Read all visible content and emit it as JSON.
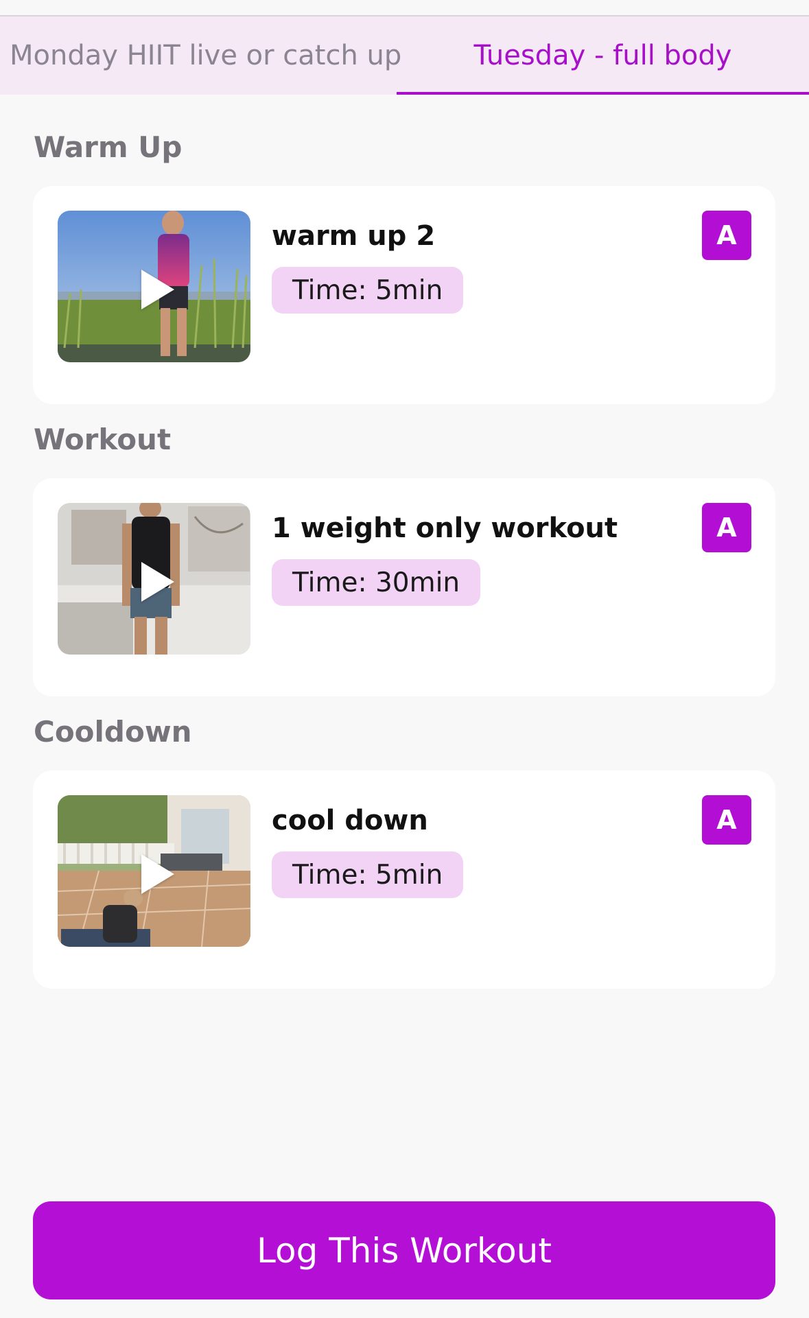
{
  "tabs": [
    {
      "label": "Monday HIIT live or catch up",
      "active": false
    },
    {
      "label": "Tuesday - full body",
      "active": true
    }
  ],
  "sections": [
    {
      "title": "Warm Up",
      "item": {
        "title": "warm up 2",
        "time": "Time: 5min",
        "badge": "A"
      }
    },
    {
      "title": "Workout",
      "item": {
        "title": "1 weight only workout",
        "time": "Time: 30min",
        "badge": "A"
      }
    },
    {
      "title": "Cooldown",
      "item": {
        "title": "cool down",
        "time": "Time: 5min",
        "badge": "A"
      }
    }
  ],
  "log_button_label": "Log This Workout",
  "colors": {
    "accent": "#b40fd5",
    "badge_bg": "#f2d2f5",
    "tab_bg": "#f5e9f5",
    "page_bg": "#f8f8f8"
  }
}
